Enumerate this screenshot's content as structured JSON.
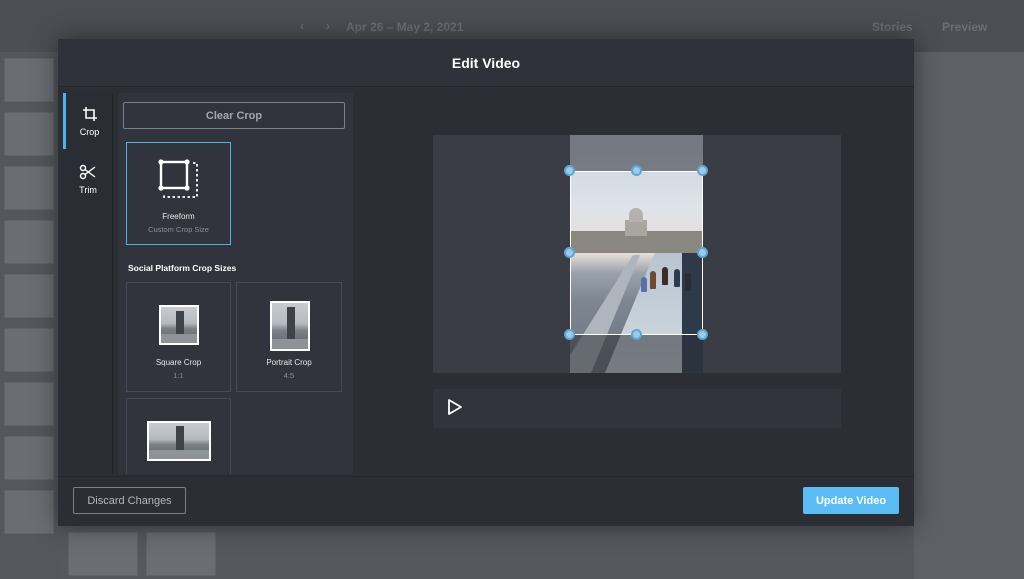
{
  "background": {
    "date_range": "Apr 26 – May 2, 2021",
    "tab_stories": "Stories",
    "tab_preview": "Preview"
  },
  "modal": {
    "title": "Edit Video",
    "tools": [
      {
        "label": "Crop",
        "icon": "crop-icon",
        "active": true
      },
      {
        "label": "Trim",
        "icon": "scissors-icon",
        "active": false
      }
    ],
    "crop_panel": {
      "clear_crop_label": "Clear Crop",
      "freeform": {
        "label": "Freeform",
        "sub": "Custom Crop Size",
        "icon": "freeform-crop-icon",
        "selected": true
      },
      "section_title": "Social Platform Crop Sizes",
      "presets": [
        {
          "label": "Square Crop",
          "ratio": "1:1"
        },
        {
          "label": "Portrait Crop",
          "ratio": "4:5"
        },
        {
          "label": "",
          "ratio": ""
        }
      ]
    },
    "preview": {
      "play_icon": "play-icon"
    },
    "footer": {
      "discard_label": "Discard Changes",
      "update_label": "Update Video"
    }
  },
  "colors": {
    "accent": "#5bbcf3",
    "active_border": "#4db3e8",
    "modal_bg": "#2b2e35"
  }
}
